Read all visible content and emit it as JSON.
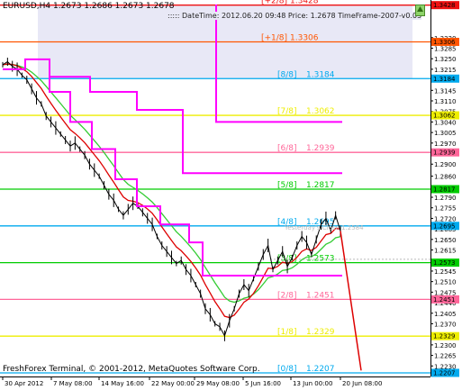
{
  "window": {
    "symbol_line": "EURUSD,H4  1.2673 1.2686 1.2673 1.2678",
    "info_line": "::::: DateTime: 2012.06.20 09:48   Price: 1.2678   TimeFrame-2007-v0.05",
    "copyright": "FreshForex Terminal, © 2001-2012, MetaQuotes Software Corp.",
    "yesterday_label": "Yesterday's Close 1.2584"
  },
  "colors": {
    "background": "#ffffff",
    "shade": "#e8e8f6",
    "price": "#000000",
    "ma_green": "#33cc33",
    "ma_red": "#dd0000",
    "trend_magenta": "#ff00ff",
    "forecast": "#dd0000"
  },
  "axis": {
    "price_ticks": [
      "1.3320",
      "1.3285",
      "1.3250",
      "1.3215",
      "1.3180",
      "1.3145",
      "1.3110",
      "1.3075",
      "1.3040",
      "1.3005",
      "1.2970",
      "1.2935",
      "1.2900",
      "1.2860",
      "1.2825",
      "1.2790",
      "1.2755",
      "1.2720",
      "1.2685",
      "1.2650",
      "1.2615",
      "1.2580",
      "1.2545",
      "1.2510",
      "1.2475",
      "1.2440",
      "1.2405",
      "1.2370",
      "1.2335",
      "1.2300",
      "1.2265",
      "1.2230"
    ],
    "time_labels": [
      "30 Apr 2012",
      "7 May 08:00",
      "14 May 16:00",
      "22 May 00:00",
      "29 May 08:00",
      "5 Jun 16:00",
      "13 Jun 00:00",
      "20 Jun 08:00"
    ]
  },
  "levels": [
    {
      "code": "[+2/8]",
      "value": "1.3428",
      "axis_label": "1.3428",
      "color": "#ee1111"
    },
    {
      "code": "[+1/8]",
      "value": "1.3306",
      "axis_label": "1.3306",
      "color": "#ff5500"
    },
    {
      "code": "[8/8]",
      "value": "1.3184",
      "axis_label": "1.3184",
      "color": "#00aaee"
    },
    {
      "code": "[7/8]",
      "value": "1.3062",
      "axis_label": "1.3062",
      "color": "#eeee00"
    },
    {
      "code": "[6/8]",
      "value": "1.2939",
      "axis_label": "1.2939",
      "color": "#ff6699"
    },
    {
      "code": "[5/8]",
      "value": "1.2817",
      "axis_label": "1.2817",
      "color": "#00cc00"
    },
    {
      "code": "[4/8]",
      "value": "1.2695",
      "axis_label": "1.2695",
      "color": "#00aaee"
    },
    {
      "code": "[3/8]",
      "value": "1.2573",
      "axis_label": "1.2573",
      "color": "#00cc00"
    },
    {
      "code": "[2/8]",
      "value": "1.2451",
      "axis_label": "1.2451",
      "color": "#ff6699"
    },
    {
      "code": "[1/8]",
      "value": "1.2329",
      "axis_label": "1.2329",
      "color": "#eeee00"
    },
    {
      "code": "[0/8]",
      "value": "1.2207",
      "axis_label": "1.2207",
      "color": "#00aaee"
    }
  ],
  "chart_data": {
    "type": "line",
    "title": "EURUSD,H4",
    "ylim": [
      1.2195,
      1.343
    ],
    "x": [
      "30 Apr 2012",
      "7 May 08:00",
      "14 May 16:00",
      "22 May 00:00",
      "29 May 08:00",
      "5 Jun 16:00",
      "13 Jun 00:00",
      "20 Jun 08:00"
    ],
    "series": [
      {
        "name": "EURUSD close",
        "values": [
          1.323,
          1.324,
          1.3225,
          1.3215,
          1.3195,
          1.318,
          1.315,
          1.312,
          1.31,
          1.306,
          1.304,
          1.302,
          1.3,
          1.298,
          1.296,
          1.297,
          1.295,
          1.293,
          1.29,
          1.288,
          1.286,
          1.283,
          1.28,
          1.278,
          1.275,
          1.273,
          1.275,
          1.277,
          1.276,
          1.274,
          1.272,
          1.27,
          1.266,
          1.263,
          1.261,
          1.259,
          1.257,
          1.258,
          1.255,
          1.253,
          1.25,
          1.247,
          1.242,
          1.24,
          1.237,
          1.236,
          1.233,
          1.238,
          1.242,
          1.247,
          1.25,
          1.248,
          1.252,
          1.256,
          1.26,
          1.263,
          1.255,
          1.258,
          1.261,
          1.256,
          1.259,
          1.263,
          1.266,
          1.264,
          1.26,
          1.265,
          1.27,
          1.272,
          1.268,
          1.273,
          1.2678
        ]
      }
    ]
  }
}
